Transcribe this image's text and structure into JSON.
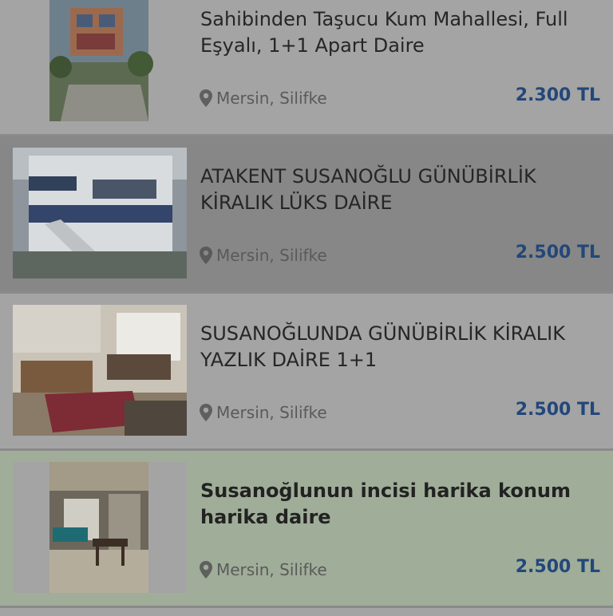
{
  "listings": [
    {
      "title": "Sahibinden Taşucu Kum Mahallesi, Full Eşyalı, 1+1 Apart Daire",
      "location": "Mersin, Silifke",
      "price": "2.300 TL",
      "image_icon": "apartment-photo-icon"
    },
    {
      "title": "ATAKENT SUSANOĞLU GÜNÜBİRLİK KİRALIK LÜKS DAİRE",
      "location": "Mersin, Silifke",
      "price": "2.500 TL",
      "image_icon": "apartment-photo-icon"
    },
    {
      "title": "SUSANOĞLUNDA GÜNÜBİRLİK KİRALIK YAZLIK DAİRE 1+1",
      "location": "Mersin, Silifke",
      "price": "2.500 TL",
      "image_icon": "apartment-photo-icon"
    },
    {
      "title": "Susanoğlunun incisi harika konum harika daire",
      "location": "Mersin, Silifke",
      "price": "2.500 TL",
      "image_icon": "apartment-photo-icon"
    }
  ],
  "colors": {
    "price": "#23477a",
    "row_bg": "#a4a4a4",
    "row_bg_dark": "#878787",
    "row_bg_highlight": "#a0ad99"
  }
}
